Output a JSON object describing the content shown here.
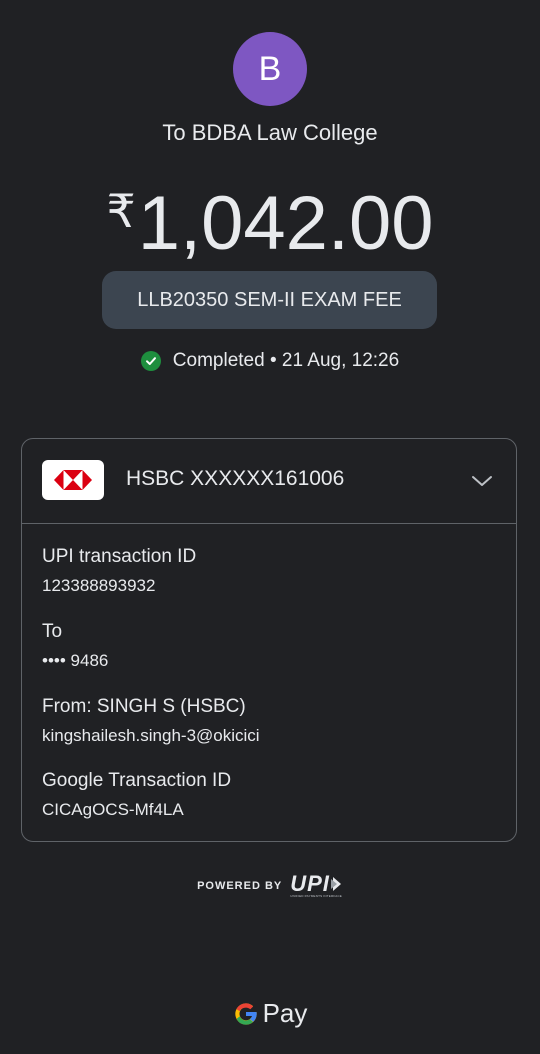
{
  "header": {
    "avatar_letter": "B",
    "recipient": "To BDBA Law College",
    "currency_symbol": "₹",
    "amount": "1,042.00",
    "note": "LLB20350 SEM-II EXAM FEE",
    "status": "Completed",
    "separator": " • ",
    "datetime": "21 Aug, 12:26"
  },
  "account": {
    "bank_name": "HSBC XXXXXX161006"
  },
  "details": [
    {
      "label": "UPI transaction ID",
      "value": "123388893932"
    },
    {
      "label": "To",
      "value": "•••• 9486"
    },
    {
      "label": "From: SINGH S (HSBC)",
      "value": "kingshailesh.singh-3@okicici"
    },
    {
      "label": "Google Transaction ID",
      "value": "CICAgOCS-Mf4LA"
    }
  ],
  "footer": {
    "powered_by": "POWERED BY",
    "upi_logo_text": "UPI",
    "upi_tagline": "UNIFIED PAYMENTS INTERFACE",
    "gpay_text": "Pay"
  },
  "colors": {
    "background": "#202124",
    "avatar": "#7e57c2",
    "chip": "#3c4550",
    "success": "#1e8e3e",
    "hsbc_red": "#db0011",
    "border": "#5f6368"
  },
  "icons": {
    "status": "check-circle-icon",
    "expand": "chevron-down-icon",
    "bank": "hsbc-logo-icon",
    "brand": "google-g-icon"
  }
}
